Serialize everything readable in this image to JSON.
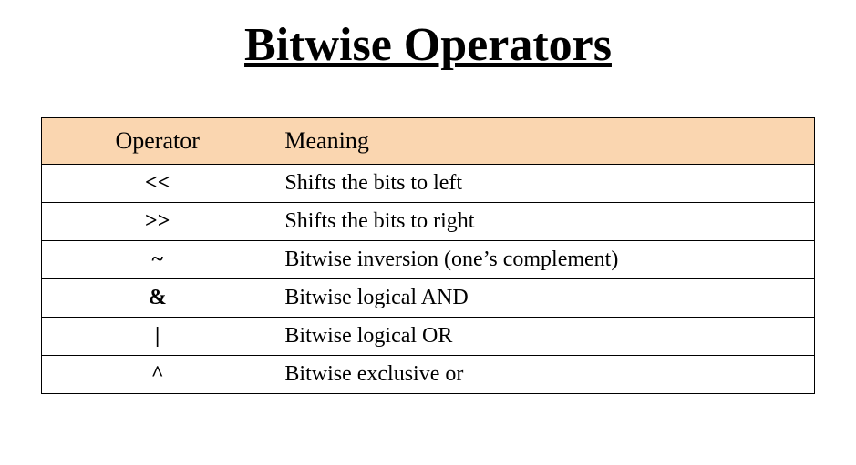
{
  "title": "Bitwise Operators",
  "table": {
    "headers": {
      "operator": "Operator",
      "meaning": "Meaning"
    },
    "rows": [
      {
        "operator": "<<",
        "meaning": "Shifts the bits to left"
      },
      {
        "operator": ">>",
        "meaning": "Shifts the bits to right"
      },
      {
        "operator": "~",
        "meaning": "Bitwise inversion (one’s complement)"
      },
      {
        "operator": "&",
        "meaning": "Bitwise logical AND"
      },
      {
        "operator": "|",
        "meaning": "Bitwise logical OR"
      },
      {
        "operator": "^",
        "meaning": "Bitwise exclusive or"
      }
    ]
  }
}
